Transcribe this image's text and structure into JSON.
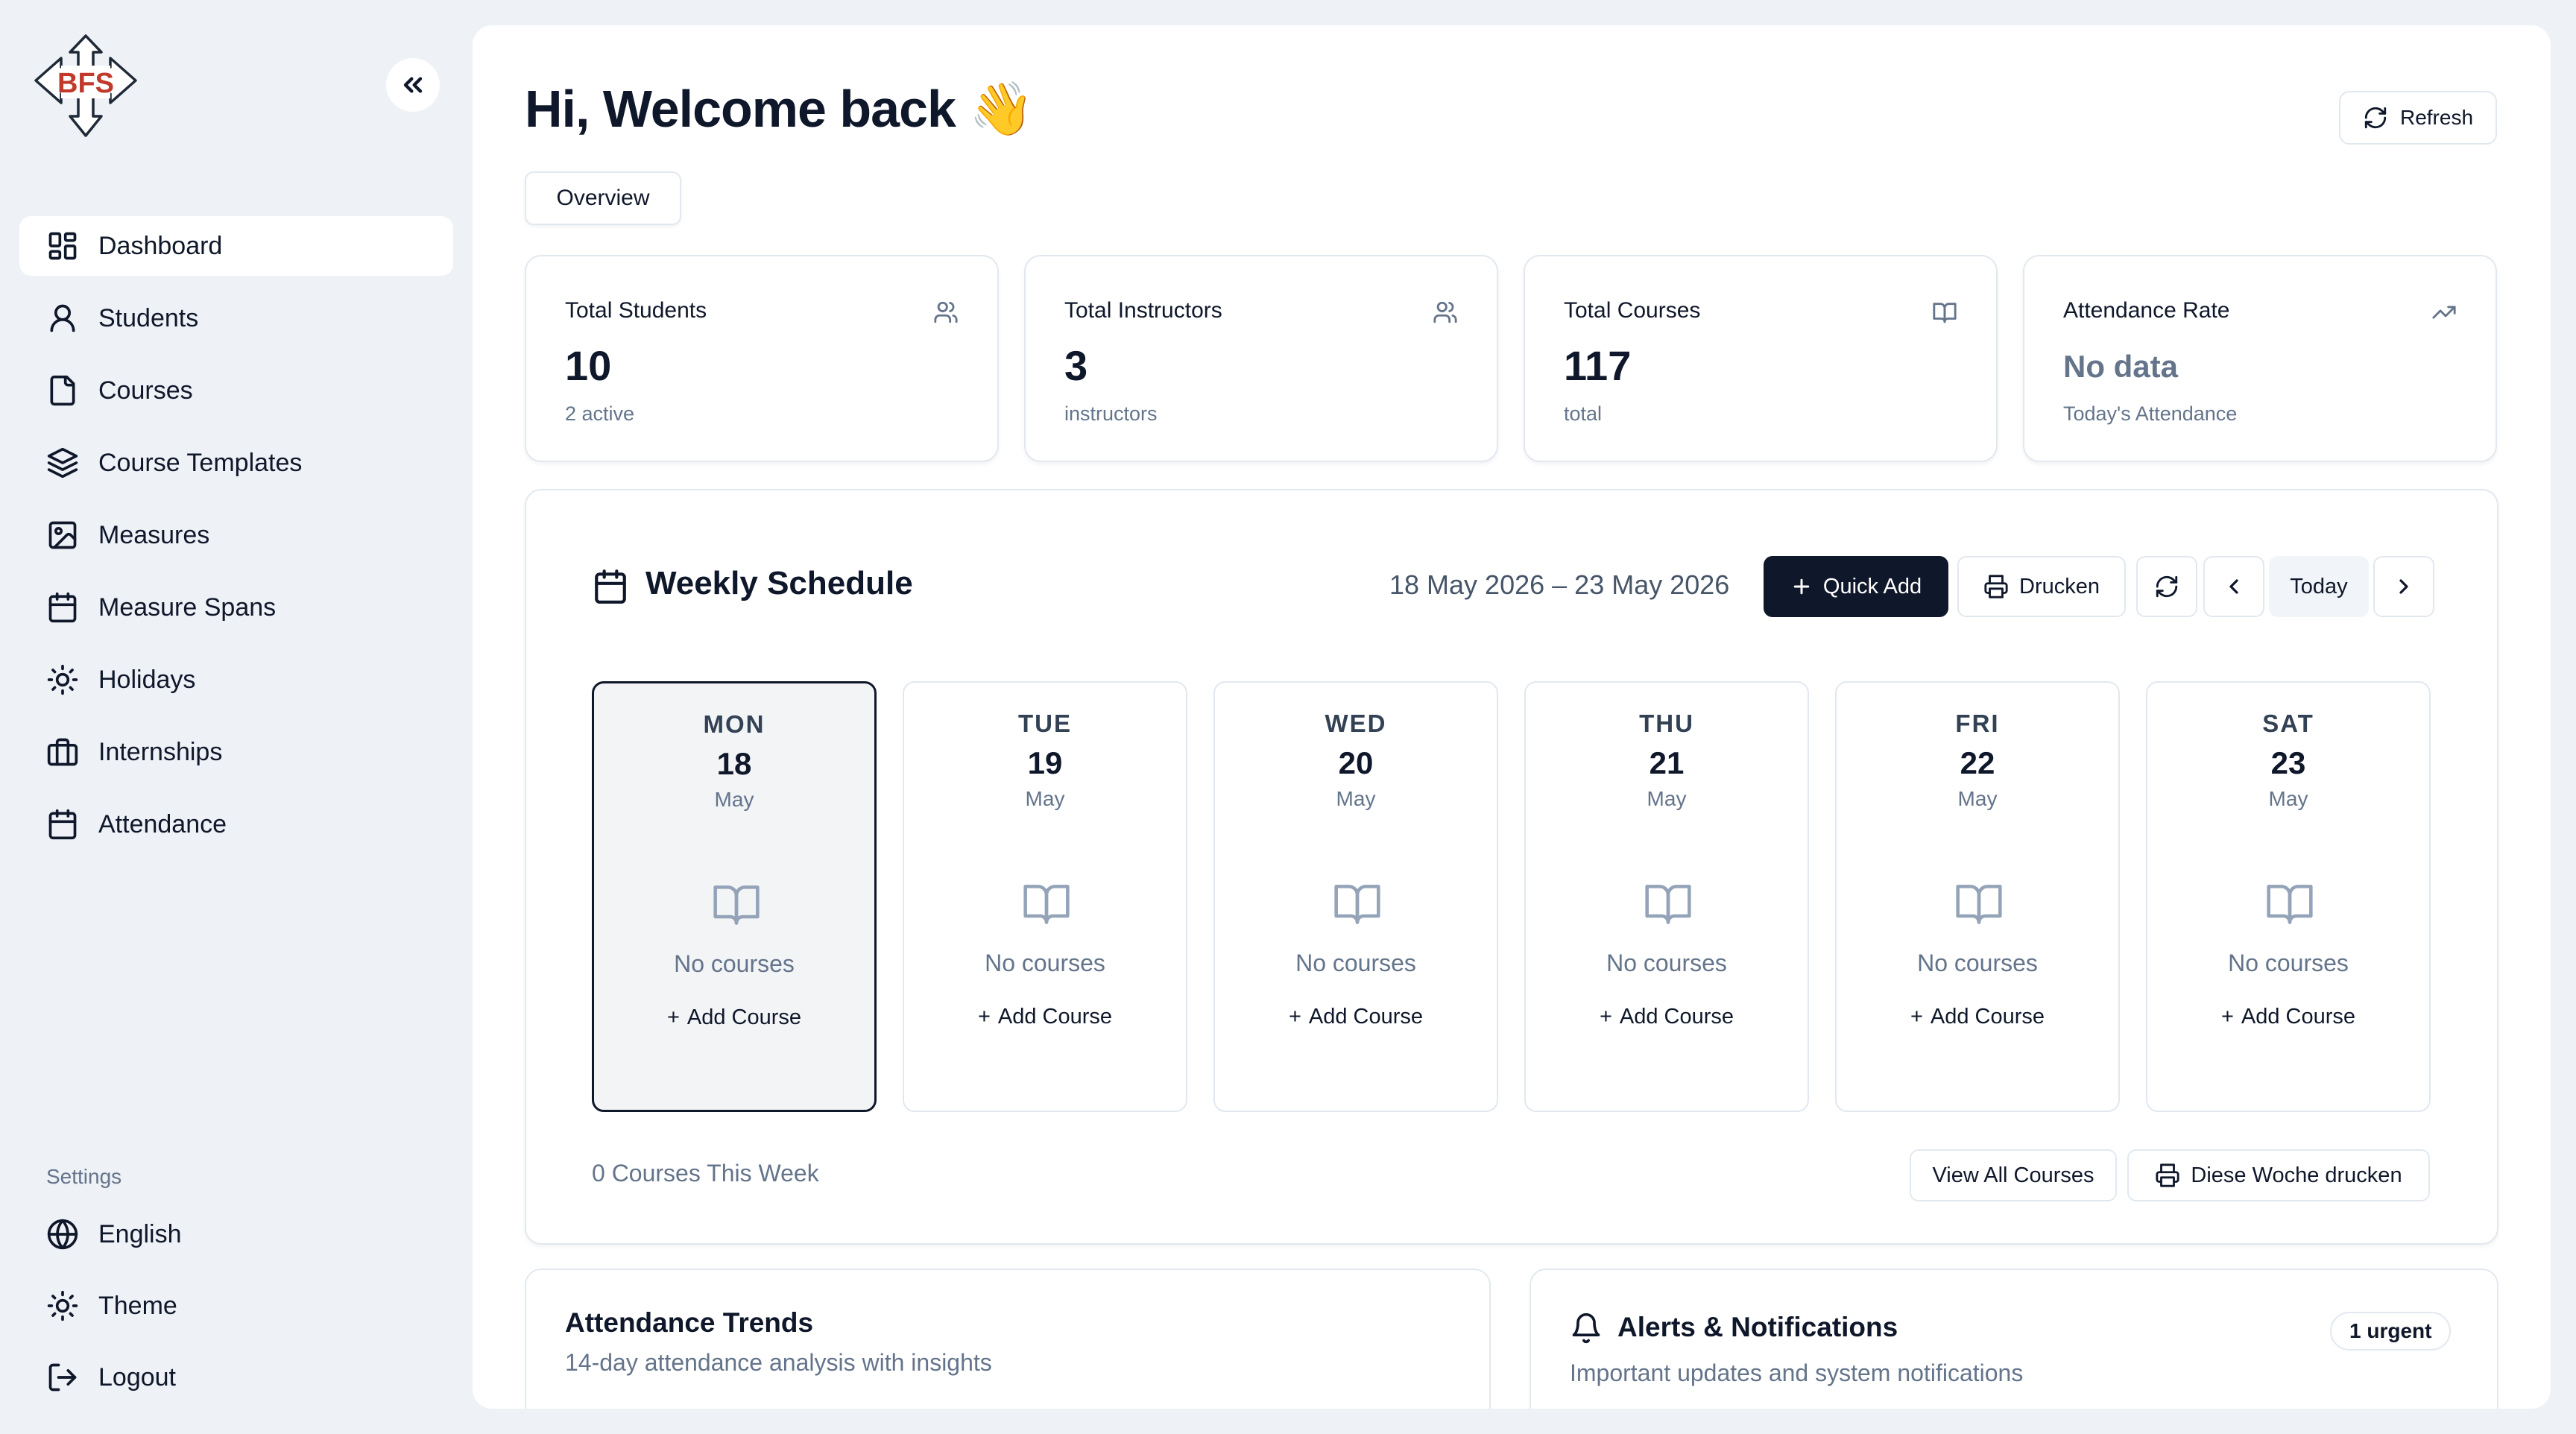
{
  "app": {
    "logo_text": "BFS",
    "brand_red": "#c0392b"
  },
  "sidebar": {
    "items": [
      {
        "label": "Dashboard",
        "icon": "dashboard-icon",
        "active": true
      },
      {
        "label": "Students",
        "icon": "user-icon"
      },
      {
        "label": "Courses",
        "icon": "file-icon"
      },
      {
        "label": "Course Templates",
        "icon": "layers-icon"
      },
      {
        "label": "Measures",
        "icon": "image-icon"
      },
      {
        "label": "Measure Spans",
        "icon": "calendar-icon"
      },
      {
        "label": "Holidays",
        "icon": "sun-icon"
      },
      {
        "label": "Internships",
        "icon": "briefcase-icon"
      },
      {
        "label": "Attendance",
        "icon": "calendar-icon"
      }
    ],
    "settings_label": "Settings",
    "settings_items": [
      {
        "label": "English",
        "icon": "globe-icon"
      },
      {
        "label": "Theme",
        "icon": "sun-icon"
      },
      {
        "label": "Logout",
        "icon": "logout-icon"
      }
    ]
  },
  "header": {
    "greeting": "Hi, Welcome back",
    "greeting_emoji": "👋",
    "refresh_label": "Refresh",
    "tab_overview": "Overview"
  },
  "stats": [
    {
      "title": "Total Students",
      "value": "10",
      "sub": "2 active",
      "icon": "users-icon"
    },
    {
      "title": "Total Instructors",
      "value": "3",
      "sub": "instructors",
      "icon": "users-icon"
    },
    {
      "title": "Total Courses",
      "value": "117",
      "sub": "total",
      "icon": "book-icon"
    },
    {
      "title": "Attendance Rate",
      "value": "No data",
      "sub": "Today's Attendance",
      "icon": "trending-up-icon"
    }
  ],
  "schedule": {
    "title": "Weekly Schedule",
    "date_range": "18 May 2026 – 23 May 2026",
    "quick_add": "Quick Add",
    "drucken": "Drucken",
    "today": "Today",
    "days": [
      {
        "dow": "MON",
        "num": "18",
        "month": "May",
        "empty": "No courses",
        "add": "Add Course",
        "is_today": true
      },
      {
        "dow": "TUE",
        "num": "19",
        "month": "May",
        "empty": "No courses",
        "add": "Add Course"
      },
      {
        "dow": "WED",
        "num": "20",
        "month": "May",
        "empty": "No courses",
        "add": "Add Course"
      },
      {
        "dow": "THU",
        "num": "21",
        "month": "May",
        "empty": "No courses",
        "add": "Add Course"
      },
      {
        "dow": "FRI",
        "num": "22",
        "month": "May",
        "empty": "No courses",
        "add": "Add Course"
      },
      {
        "dow": "SAT",
        "num": "23",
        "month": "May",
        "empty": "No courses",
        "add": "Add Course"
      }
    ],
    "week_count": "0 Courses This Week",
    "view_all": "View All Courses",
    "print_week": "Diese Woche drucken"
  },
  "trends": {
    "title": "Attendance Trends",
    "subtitle": "14-day attendance analysis with insights"
  },
  "alerts": {
    "title": "Alerts & Notifications",
    "subtitle": "Important updates and system notifications",
    "badge": "1 urgent"
  }
}
